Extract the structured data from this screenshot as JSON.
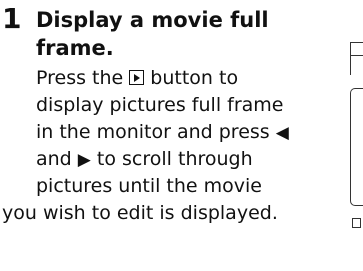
{
  "step": {
    "number": "1",
    "title": "Display a movie full frame."
  },
  "instructions": {
    "line1_before_icon": "Press the ",
    "line1_after_icon": " button to",
    "line2": "display pictures full frame",
    "line3_before_arrow": "in the monitor and press ",
    "line4_before_arrow": "and ",
    "line4_after_arrow": " to scroll through",
    "line5": "pictures until the movie",
    "line6": "you wish to edit is displayed."
  },
  "glyphs": {
    "left_arrow": "◀",
    "right_arrow": "▶"
  },
  "icons": {
    "playback_button": "play-button-icon",
    "left_arrow": "left-arrow-icon",
    "right_arrow": "right-arrow-icon"
  }
}
